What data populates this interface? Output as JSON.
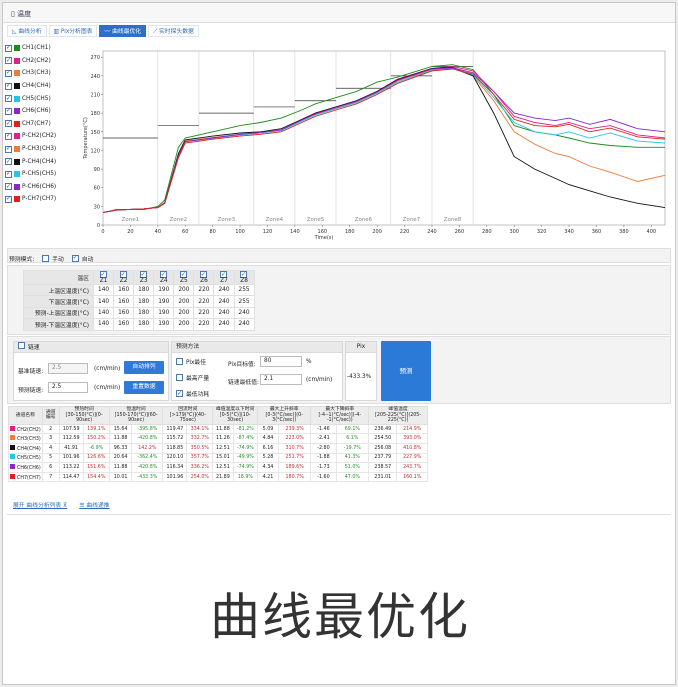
{
  "window": {
    "title": "温度"
  },
  "tabs": [
    {
      "label": "曲线分析",
      "active": false
    },
    {
      "label": "Pix分析图表",
      "active": false
    },
    {
      "label": "曲线最优化",
      "active": true
    },
    {
      "label": "实时探头数据",
      "active": false
    }
  ],
  "channels": [
    {
      "label": "CH1(CH1)",
      "color": "#1a8c1a",
      "checked": true
    },
    {
      "label": "CH2(CH2)",
      "color": "#e0208a",
      "checked": true
    },
    {
      "label": "CH3(CH3)",
      "color": "#f07a3a",
      "checked": true
    },
    {
      "label": "CH4(CH4)",
      "color": "#111111",
      "checked": true
    },
    {
      "label": "CH5(CH5)",
      "color": "#27c4e6",
      "checked": true
    },
    {
      "label": "CH6(CH6)",
      "color": "#8a28c8",
      "checked": true
    },
    {
      "label": "CH7(CH7)",
      "color": "#e02020",
      "checked": true
    },
    {
      "label": "P-CH2(CH2)",
      "color": "#e0208a",
      "checked": true
    },
    {
      "label": "P-CH3(CH3)",
      "color": "#f07a3a",
      "checked": true
    },
    {
      "label": "P-CH4(CH4)",
      "color": "#111111",
      "checked": true
    },
    {
      "label": "P-CH5(CH5)",
      "color": "#27c4e6",
      "checked": true
    },
    {
      "label": "P-CH6(CH6)",
      "color": "#8a28c8",
      "checked": true
    },
    {
      "label": "P-CH7(CH7)",
      "color": "#e02020",
      "checked": true
    }
  ],
  "chart_data": {
    "type": "line",
    "xlabel": "Time(s)",
    "ylabel": "Temperature(°C)",
    "xlim": [
      0,
      410
    ],
    "ylim": [
      0,
      280
    ],
    "xticks": [
      0,
      20,
      40,
      60,
      80,
      100,
      120,
      140,
      160,
      180,
      200,
      220,
      240,
      260,
      280,
      300,
      320,
      340,
      360,
      380,
      400
    ],
    "yticks": [
      0.0,
      30.0,
      60.0,
      90.0,
      120.0,
      150.0,
      180.0,
      210.0,
      240.0,
      270.0
    ],
    "zones": [
      {
        "label": "Zone1",
        "x0": 0,
        "x1": 40,
        "set": 140
      },
      {
        "label": "Zone2",
        "x0": 40,
        "x1": 70,
        "set": 160
      },
      {
        "label": "Zone3",
        "x0": 70,
        "x1": 110,
        "set": 180
      },
      {
        "label": "Zone4",
        "x0": 110,
        "x1": 140,
        "set": 190
      },
      {
        "label": "Zone5",
        "x0": 140,
        "x1": 170,
        "set": 200
      },
      {
        "label": "Zone6",
        "x0": 170,
        "x1": 210,
        "set": 220
      },
      {
        "label": "Zone7",
        "x0": 210,
        "x1": 240,
        "set": 240
      },
      {
        "label": "Zone8",
        "x0": 240,
        "x1": 270,
        "set": 255
      }
    ],
    "series": [
      {
        "color": "#1a8c1a",
        "x": [
          0,
          10,
          30,
          40,
          45,
          55,
          60,
          80,
          100,
          115,
          130,
          145,
          155,
          170,
          185,
          200,
          215,
          240,
          255,
          270,
          285,
          300,
          315,
          330,
          340,
          355,
          370,
          390,
          410
        ],
        "y": [
          20,
          25,
          25,
          30,
          40,
          125,
          140,
          150,
          160,
          165,
          172,
          185,
          195,
          205,
          215,
          230,
          238,
          255,
          258,
          250,
          210,
          160,
          150,
          145,
          140,
          132,
          128,
          125,
          125
        ]
      },
      {
        "color": "#e0208a",
        "x": [
          0,
          10,
          30,
          40,
          45,
          55,
          60,
          80,
          100,
          115,
          130,
          145,
          155,
          170,
          185,
          200,
          215,
          240,
          255,
          270,
          285,
          300,
          315,
          330,
          340,
          355,
          370,
          390,
          410
        ],
        "y": [
          20,
          24,
          26,
          28,
          35,
          110,
          135,
          140,
          145,
          148,
          152,
          170,
          180,
          190,
          200,
          215,
          235,
          252,
          255,
          248,
          215,
          175,
          165,
          160,
          165,
          155,
          160,
          145,
          140
        ]
      },
      {
        "color": "#f07a3a",
        "x": [
          0,
          10,
          30,
          40,
          45,
          55,
          60,
          80,
          100,
          115,
          130,
          145,
          155,
          170,
          185,
          200,
          215,
          240,
          255,
          270,
          285,
          300,
          315,
          330,
          340,
          355,
          370,
          390,
          410
        ],
        "y": [
          20,
          24,
          26,
          28,
          35,
          112,
          135,
          141,
          146,
          149,
          153,
          168,
          178,
          188,
          198,
          213,
          232,
          250,
          252,
          240,
          200,
          150,
          130,
          115,
          110,
          95,
          85,
          70,
          80
        ]
      },
      {
        "color": "#111111",
        "x": [
          0,
          10,
          30,
          40,
          45,
          55,
          60,
          80,
          100,
          115,
          130,
          145,
          155,
          170,
          185,
          200,
          215,
          240,
          255,
          270,
          285,
          300,
          315,
          330,
          340,
          355,
          370,
          390,
          410
        ],
        "y": [
          20,
          24,
          26,
          28,
          36,
          115,
          137,
          143,
          148,
          150,
          155,
          170,
          180,
          190,
          200,
          215,
          234,
          252,
          254,
          240,
          180,
          110,
          90,
          75,
          65,
          55,
          45,
          35,
          28
        ]
      },
      {
        "color": "#27c4e6",
        "x": [
          0,
          10,
          30,
          40,
          45,
          55,
          60,
          80,
          100,
          115,
          130,
          145,
          155,
          170,
          185,
          200,
          215,
          240,
          255,
          270,
          285,
          300,
          315,
          330,
          340,
          355,
          370,
          390,
          410
        ],
        "y": [
          20,
          24,
          26,
          28,
          35,
          110,
          134,
          140,
          145,
          148,
          152,
          167,
          177,
          187,
          197,
          212,
          230,
          249,
          252,
          242,
          205,
          165,
          150,
          145,
          150,
          140,
          148,
          135,
          132
        ]
      },
      {
        "color": "#8a28c8",
        "x": [
          0,
          10,
          30,
          40,
          45,
          55,
          60,
          80,
          100,
          115,
          130,
          145,
          155,
          170,
          185,
          200,
          215,
          240,
          255,
          270,
          285,
          300,
          315,
          330,
          340,
          355,
          370,
          390,
          410
        ],
        "y": [
          20,
          24,
          26,
          28,
          35,
          111,
          134,
          140,
          146,
          149,
          153,
          169,
          179,
          189,
          199,
          214,
          233,
          251,
          253,
          245,
          215,
          180,
          172,
          168,
          172,
          162,
          170,
          155,
          150
        ]
      },
      {
        "color": "#e02020",
        "x": [
          0,
          10,
          30,
          40,
          45,
          55,
          60,
          80,
          100,
          115,
          130,
          145,
          155,
          170,
          185,
          200,
          215,
          240,
          255,
          270,
          285,
          300,
          315,
          330,
          340,
          355,
          370,
          390,
          410
        ],
        "y": [
          20,
          24,
          26,
          28,
          35,
          108,
          132,
          138,
          143,
          146,
          150,
          165,
          175,
          185,
          195,
          210,
          228,
          248,
          251,
          243,
          210,
          170,
          160,
          158,
          162,
          150,
          156,
          142,
          138
        ]
      }
    ]
  },
  "mode": {
    "label": "预测模式:",
    "options": [
      {
        "label": "手动",
        "checked": false
      },
      {
        "label": "自动",
        "checked": true
      }
    ]
  },
  "zone_table": {
    "head_label": "温区",
    "zones": [
      "Z1",
      "Z2",
      "Z3",
      "Z4",
      "Z5",
      "Z6",
      "Z7",
      "Z8"
    ],
    "rows": [
      {
        "label": "上温区温度(°C)",
        "values": [
          "140",
          "160",
          "180",
          "190",
          "200",
          "220",
          "240",
          "255"
        ]
      },
      {
        "label": "下温区温度(°C)",
        "values": [
          "140",
          "160",
          "180",
          "190",
          "200",
          "220",
          "240",
          "255"
        ]
      },
      {
        "label": "预测-上温区温度(°C)",
        "values": [
          "140",
          "160",
          "180",
          "190",
          "200",
          "220",
          "240",
          "240"
        ]
      },
      {
        "label": "预测-下温区温度(°C)",
        "values": [
          "140",
          "160",
          "180",
          "190",
          "200",
          "220",
          "240",
          "240"
        ]
      }
    ]
  },
  "speed_panel": {
    "title": "链速",
    "base_label": "基准链速:",
    "base_value": "2.5",
    "base_unit": "(cm/min)",
    "pred_label": "预测链速:",
    "pred_value": "2.5",
    "pred_unit": "(cm/min)",
    "auto_button": "自动排列",
    "reset_button": "重置数据"
  },
  "method_panel": {
    "title": "预测方法",
    "options": [
      {
        "label": "Pix最佳",
        "checked": false
      },
      {
        "label": "最高产量",
        "checked": false
      },
      {
        "label": "最低功耗",
        "checked": true
      }
    ],
    "pix_target_label": "Pix目标值:",
    "pix_target_value": "80",
    "pix_target_unit": "%",
    "min_speed_label": "链速最低值:",
    "min_speed_value": "2.1",
    "min_speed_unit": "(cm/min)"
  },
  "pix_panel": {
    "title": "Pix",
    "value": "-433.3%"
  },
  "predict_button": "预测",
  "result_table": {
    "headers": [
      "通道名称",
      "通道编号",
      "预热时间\n[30-150(°C)](0-90sec)",
      "",
      "恒温时间\n[150-170(°C)](60-90sec)",
      "",
      "回流时间\n[>179(°C)](40-75sec)",
      "",
      "峰值温度以下时间\n[0-5(°C)](10-30sec)",
      "",
      "最大上升斜率\n[0-3(°C/sec)](0-3(°C/sec))",
      "",
      "最大下降斜率\n[-4--1(°C/sec)](-4--1(°C/sec))",
      "",
      "峰值温度\n[205-225(°C)](205-225(°C))",
      ""
    ],
    "rows": [
      {
        "channel": "CH2(CH2)",
        "color": "#e0208a",
        "cells": [
          "2",
          "107.59",
          "139.1%",
          "15.64",
          "-395.8%",
          "119.47",
          "334.1%",
          "11.88",
          "-81.2%",
          "5.09",
          "239.3%",
          "-1.46",
          "69.1%",
          "236.49",
          "214.9%"
        ],
        "tones": [
          "",
          "",
          "r",
          "",
          "g",
          "",
          "r",
          "",
          "g",
          "",
          "r",
          "",
          "g",
          "",
          "r"
        ]
      },
      {
        "channel": "CH3(CH3)",
        "color": "#f07a3a",
        "cells": [
          "3",
          "112.59",
          "150.2%",
          "11.88",
          "-420.8%",
          "115.72",
          "332.7%",
          "11.26",
          "-87.4%",
          "4.84",
          "223.0%",
          "-2.41",
          "6.1%",
          "254.50",
          "393.0%"
        ],
        "tones": [
          "",
          "",
          "r",
          "",
          "g",
          "",
          "r",
          "",
          "g",
          "",
          "r",
          "",
          "g",
          "",
          "r"
        ]
      },
      {
        "channel": "CH4(CH4)",
        "color": "#111111",
        "cells": [
          "4",
          "41.91",
          "-6.9%",
          "96.33",
          "142.2%",
          "118.85",
          "350.5%",
          "12.51",
          "-74.9%",
          "6.16",
          "310.7%",
          "-2.80",
          "-19.7%",
          "256.08",
          "410.8%"
        ],
        "tones": [
          "",
          "",
          "g",
          "",
          "r",
          "",
          "r",
          "",
          "g",
          "",
          "r",
          "",
          "g",
          "",
          "r"
        ]
      },
      {
        "channel": "CH5(CH5)",
        "color": "#27c4e6",
        "cells": [
          "5",
          "101.96",
          "126.6%",
          "20.64",
          "-362.4%",
          "120.10",
          "357.7%",
          "15.01",
          "-49.9%",
          "5.28",
          "251.7%",
          "-1.88",
          "41.3%",
          "237.79",
          "227.9%"
        ],
        "tones": [
          "",
          "",
          "r",
          "",
          "g",
          "",
          "r",
          "",
          "g",
          "",
          "r",
          "",
          "g",
          "",
          "r"
        ]
      },
      {
        "channel": "CH6(CH6)",
        "color": "#8a28c8",
        "cells": [
          "6",
          "113.22",
          "151.6%",
          "11.88",
          "-420.8%",
          "116.34",
          "336.2%",
          "12.51",
          "-74.9%",
          "4.34",
          "189.6%",
          "-1.73",
          "51.0%",
          "238.57",
          "243.7%"
        ],
        "tones": [
          "",
          "",
          "r",
          "",
          "g",
          "",
          "r",
          "",
          "g",
          "",
          "r",
          "",
          "g",
          "",
          "r"
        ]
      },
      {
        "channel": "CH7(CH7)",
        "color": "#e02020",
        "cells": [
          "7",
          "114.47",
          "154.4%",
          "10.01",
          "-433.3%",
          "101.96",
          "254.0%",
          "21.89",
          "18.9%",
          "4.21",
          "180.7%",
          "-1.60",
          "47.0%",
          "231.01",
          "160.1%"
        ],
        "tones": [
          "",
          "",
          "r",
          "",
          "g",
          "",
          "r",
          "",
          "g",
          "",
          "r",
          "",
          "g",
          "",
          "r"
        ]
      }
    ]
  },
  "links": {
    "expand": "展开 曲线分析列表 ⊼",
    "settings": "☰ 曲线递推"
  },
  "caption": "曲线最优化"
}
